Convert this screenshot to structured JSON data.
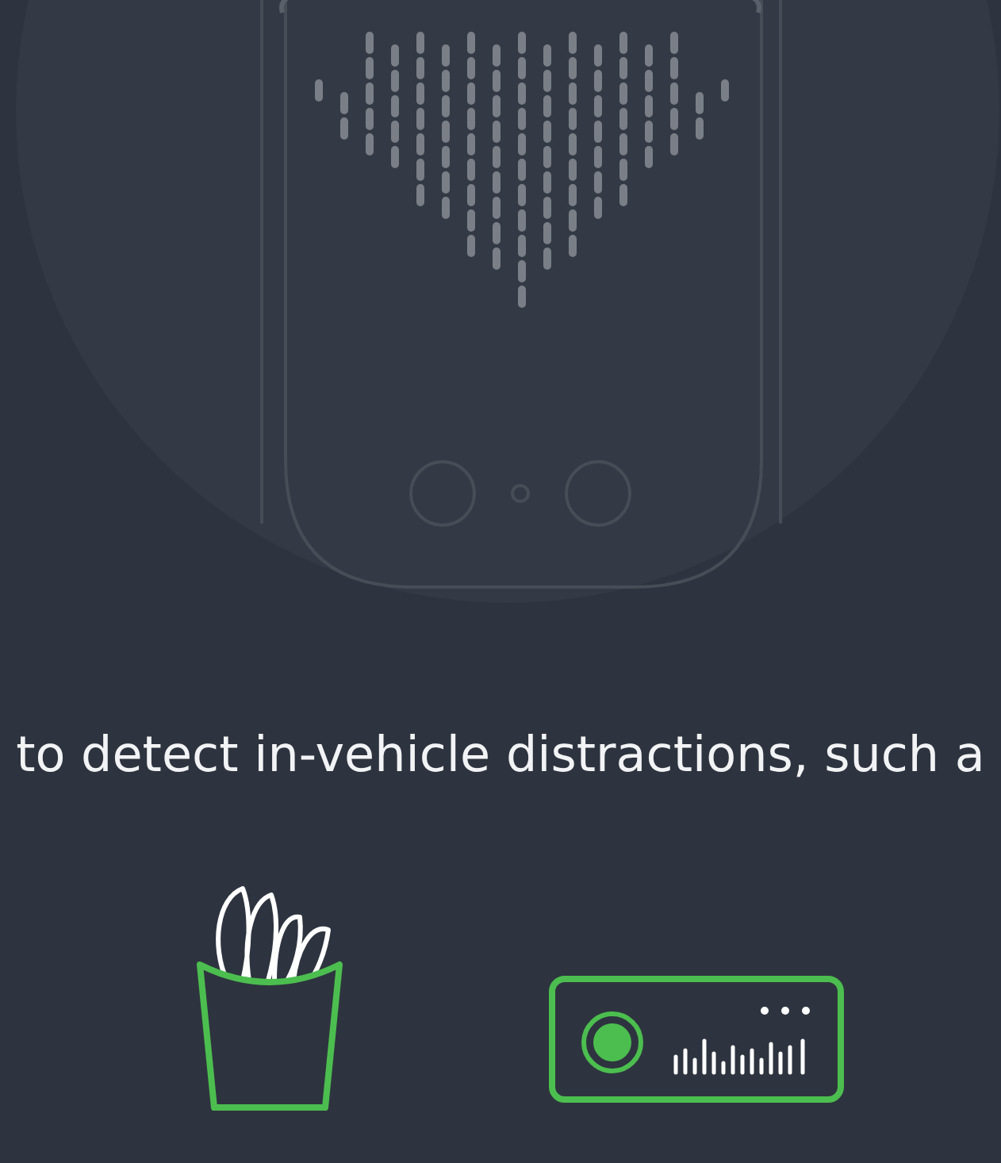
{
  "caption": "to detect in-vehicle distractions, such a"
}
